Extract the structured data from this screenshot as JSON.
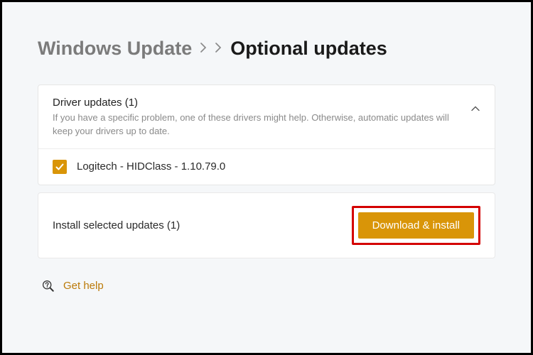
{
  "breadcrumb": {
    "parent": "Windows Update",
    "current": "Optional updates"
  },
  "driverSection": {
    "title": "Driver updates (1)",
    "subtitle": "If you have a specific problem, one of these drivers might help. Otherwise, automatic updates will keep your drivers up to date.",
    "items": [
      {
        "label": "Logitech - HIDClass - 1.10.79.0",
        "checked": true
      }
    ]
  },
  "installBar": {
    "label": "Install selected updates (1)",
    "button": "Download & install"
  },
  "help": {
    "label": "Get help"
  },
  "colors": {
    "accent": "#d99508",
    "highlight": "#d40000"
  }
}
